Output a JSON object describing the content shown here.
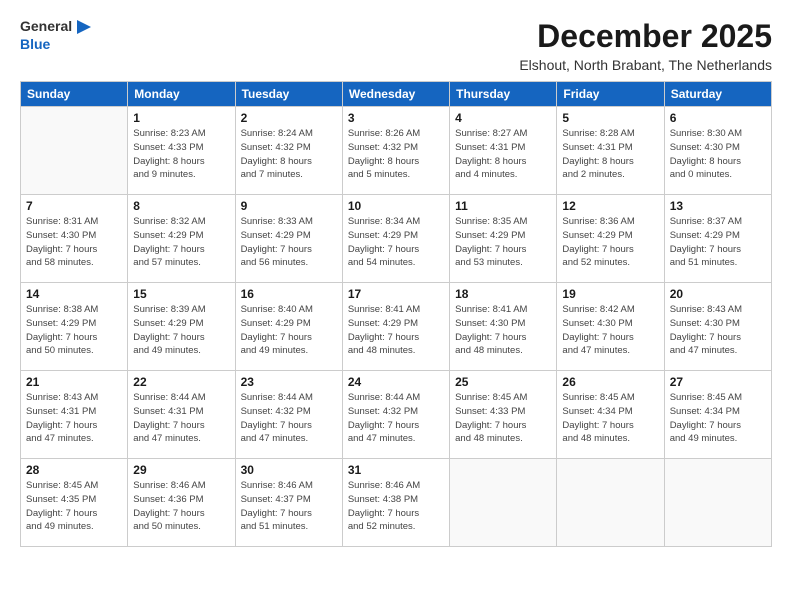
{
  "header": {
    "logo_line1": "General",
    "logo_line2": "Blue",
    "month_title": "December 2025",
    "location": "Elshout, North Brabant, The Netherlands"
  },
  "days_of_week": [
    "Sunday",
    "Monday",
    "Tuesday",
    "Wednesday",
    "Thursday",
    "Friday",
    "Saturday"
  ],
  "weeks": [
    [
      {
        "day": "",
        "info": ""
      },
      {
        "day": "1",
        "info": "Sunrise: 8:23 AM\nSunset: 4:33 PM\nDaylight: 8 hours\nand 9 minutes."
      },
      {
        "day": "2",
        "info": "Sunrise: 8:24 AM\nSunset: 4:32 PM\nDaylight: 8 hours\nand 7 minutes."
      },
      {
        "day": "3",
        "info": "Sunrise: 8:26 AM\nSunset: 4:32 PM\nDaylight: 8 hours\nand 5 minutes."
      },
      {
        "day": "4",
        "info": "Sunrise: 8:27 AM\nSunset: 4:31 PM\nDaylight: 8 hours\nand 4 minutes."
      },
      {
        "day": "5",
        "info": "Sunrise: 8:28 AM\nSunset: 4:31 PM\nDaylight: 8 hours\nand 2 minutes."
      },
      {
        "day": "6",
        "info": "Sunrise: 8:30 AM\nSunset: 4:30 PM\nDaylight: 8 hours\nand 0 minutes."
      }
    ],
    [
      {
        "day": "7",
        "info": "Sunrise: 8:31 AM\nSunset: 4:30 PM\nDaylight: 7 hours\nand 58 minutes."
      },
      {
        "day": "8",
        "info": "Sunrise: 8:32 AM\nSunset: 4:29 PM\nDaylight: 7 hours\nand 57 minutes."
      },
      {
        "day": "9",
        "info": "Sunrise: 8:33 AM\nSunset: 4:29 PM\nDaylight: 7 hours\nand 56 minutes."
      },
      {
        "day": "10",
        "info": "Sunrise: 8:34 AM\nSunset: 4:29 PM\nDaylight: 7 hours\nand 54 minutes."
      },
      {
        "day": "11",
        "info": "Sunrise: 8:35 AM\nSunset: 4:29 PM\nDaylight: 7 hours\nand 53 minutes."
      },
      {
        "day": "12",
        "info": "Sunrise: 8:36 AM\nSunset: 4:29 PM\nDaylight: 7 hours\nand 52 minutes."
      },
      {
        "day": "13",
        "info": "Sunrise: 8:37 AM\nSunset: 4:29 PM\nDaylight: 7 hours\nand 51 minutes."
      }
    ],
    [
      {
        "day": "14",
        "info": "Sunrise: 8:38 AM\nSunset: 4:29 PM\nDaylight: 7 hours\nand 50 minutes."
      },
      {
        "day": "15",
        "info": "Sunrise: 8:39 AM\nSunset: 4:29 PM\nDaylight: 7 hours\nand 49 minutes."
      },
      {
        "day": "16",
        "info": "Sunrise: 8:40 AM\nSunset: 4:29 PM\nDaylight: 7 hours\nand 49 minutes."
      },
      {
        "day": "17",
        "info": "Sunrise: 8:41 AM\nSunset: 4:29 PM\nDaylight: 7 hours\nand 48 minutes."
      },
      {
        "day": "18",
        "info": "Sunrise: 8:41 AM\nSunset: 4:30 PM\nDaylight: 7 hours\nand 48 minutes."
      },
      {
        "day": "19",
        "info": "Sunrise: 8:42 AM\nSunset: 4:30 PM\nDaylight: 7 hours\nand 47 minutes."
      },
      {
        "day": "20",
        "info": "Sunrise: 8:43 AM\nSunset: 4:30 PM\nDaylight: 7 hours\nand 47 minutes."
      }
    ],
    [
      {
        "day": "21",
        "info": "Sunrise: 8:43 AM\nSunset: 4:31 PM\nDaylight: 7 hours\nand 47 minutes."
      },
      {
        "day": "22",
        "info": "Sunrise: 8:44 AM\nSunset: 4:31 PM\nDaylight: 7 hours\nand 47 minutes."
      },
      {
        "day": "23",
        "info": "Sunrise: 8:44 AM\nSunset: 4:32 PM\nDaylight: 7 hours\nand 47 minutes."
      },
      {
        "day": "24",
        "info": "Sunrise: 8:44 AM\nSunset: 4:32 PM\nDaylight: 7 hours\nand 47 minutes."
      },
      {
        "day": "25",
        "info": "Sunrise: 8:45 AM\nSunset: 4:33 PM\nDaylight: 7 hours\nand 48 minutes."
      },
      {
        "day": "26",
        "info": "Sunrise: 8:45 AM\nSunset: 4:34 PM\nDaylight: 7 hours\nand 48 minutes."
      },
      {
        "day": "27",
        "info": "Sunrise: 8:45 AM\nSunset: 4:34 PM\nDaylight: 7 hours\nand 49 minutes."
      }
    ],
    [
      {
        "day": "28",
        "info": "Sunrise: 8:45 AM\nSunset: 4:35 PM\nDaylight: 7 hours\nand 49 minutes."
      },
      {
        "day": "29",
        "info": "Sunrise: 8:46 AM\nSunset: 4:36 PM\nDaylight: 7 hours\nand 50 minutes."
      },
      {
        "day": "30",
        "info": "Sunrise: 8:46 AM\nSunset: 4:37 PM\nDaylight: 7 hours\nand 51 minutes."
      },
      {
        "day": "31",
        "info": "Sunrise: 8:46 AM\nSunset: 4:38 PM\nDaylight: 7 hours\nand 52 minutes."
      },
      {
        "day": "",
        "info": ""
      },
      {
        "day": "",
        "info": ""
      },
      {
        "day": "",
        "info": ""
      }
    ]
  ]
}
